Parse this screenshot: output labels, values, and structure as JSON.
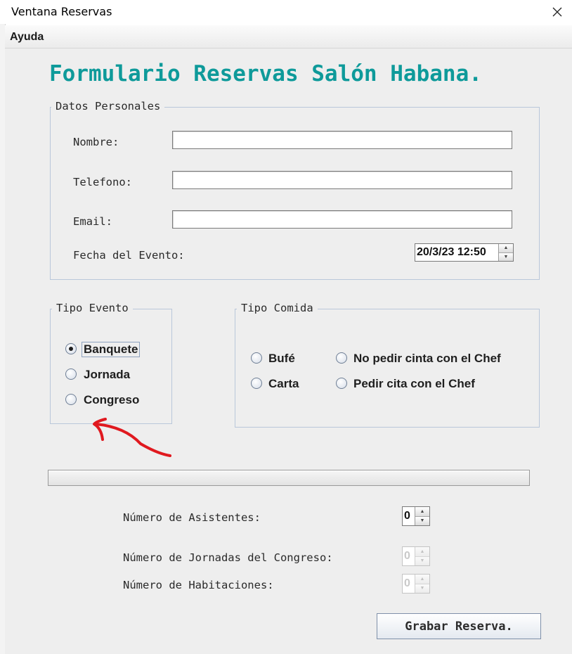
{
  "window": {
    "title": "Ventana Reservas",
    "close_icon": "close-icon"
  },
  "menu": {
    "items": [
      "Ayuda"
    ]
  },
  "form_title": "Formulario Reservas Salón Habana.",
  "personal": {
    "legend": "Datos Personales",
    "nombre_label": "Nombre:",
    "nombre_value": "",
    "telefono_label": "Telefono:",
    "telefono_value": "",
    "email_label": "Email:",
    "email_value": "",
    "fecha_label": "Fecha del Evento:",
    "fecha_value": "20/3/23 12:50"
  },
  "tipo_evento": {
    "legend": "Tipo Evento",
    "options": [
      "Banquete",
      "Jornada",
      "Congreso"
    ],
    "selected": "Banquete"
  },
  "tipo_comida": {
    "legend": "Tipo Comida",
    "options": [
      "Bufé",
      "Carta",
      "No pedir cinta con el Chef",
      "Pedir cita con el Chef"
    ]
  },
  "progress": {
    "value": 0
  },
  "asistentes": {
    "label": "Número de Asistentes:",
    "value": "0",
    "enabled": true
  },
  "jornadas": {
    "label": "Número de Jornadas del Congreso:",
    "value": "0",
    "enabled": false
  },
  "habitaciones": {
    "label": "Número de Habitaciones:",
    "value": "0",
    "enabled": false
  },
  "submit_label": "Grabar Reserva.",
  "colors": {
    "title": "#0e9a9a",
    "annotation_arrow": "#e0191f",
    "group_border": "#b9c7da",
    "background": "#eeeeee"
  }
}
